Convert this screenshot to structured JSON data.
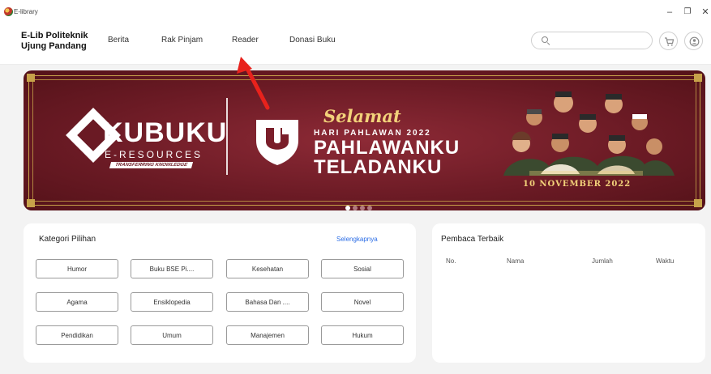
{
  "window": {
    "title": "E-library",
    "minimize": "–",
    "maximize": "❐",
    "close": "✕"
  },
  "header": {
    "brand_line1": "E-Lib Politeknik",
    "brand_line2": "Ujung Pandang",
    "nav": [
      "Berita",
      "Rak Pinjam",
      "Reader",
      "Donasi Buku"
    ],
    "search_placeholder": "",
    "search_value": ""
  },
  "banner": {
    "brand": "KUBUKU",
    "brand_sub": "E-RESOURCES",
    "brand_tagline": "TRANSFERRING KNOWLEDGE",
    "greeting": "Selamat",
    "event": "HARI PAHLAWAN 2022",
    "headline1": "PAHLAWANKU",
    "headline2": "TELADANKU",
    "date": "10 NOVEMBER 2022",
    "colors": {
      "background": "#6a1a24",
      "gold": "#c7a24a"
    }
  },
  "carousel": {
    "count": 4,
    "active": 1
  },
  "categories": {
    "title": "Kategori Pilihan",
    "more_link": "Selengkapnya",
    "items": [
      "Humor",
      "Buku BSE Pi....",
      "Kesehatan",
      "Sosial",
      "Agama",
      "Ensiklopedia",
      "Bahasa Dan ....",
      "Novel",
      "Pendidikan",
      "Umum",
      "Manajemen",
      "Hukum"
    ]
  },
  "leaderboard": {
    "title": "Pembaca Terbaik",
    "columns": [
      "No.",
      "Nama",
      "Jumlah",
      "Waktu"
    ]
  },
  "annotation": {
    "color": "#e8221c"
  }
}
